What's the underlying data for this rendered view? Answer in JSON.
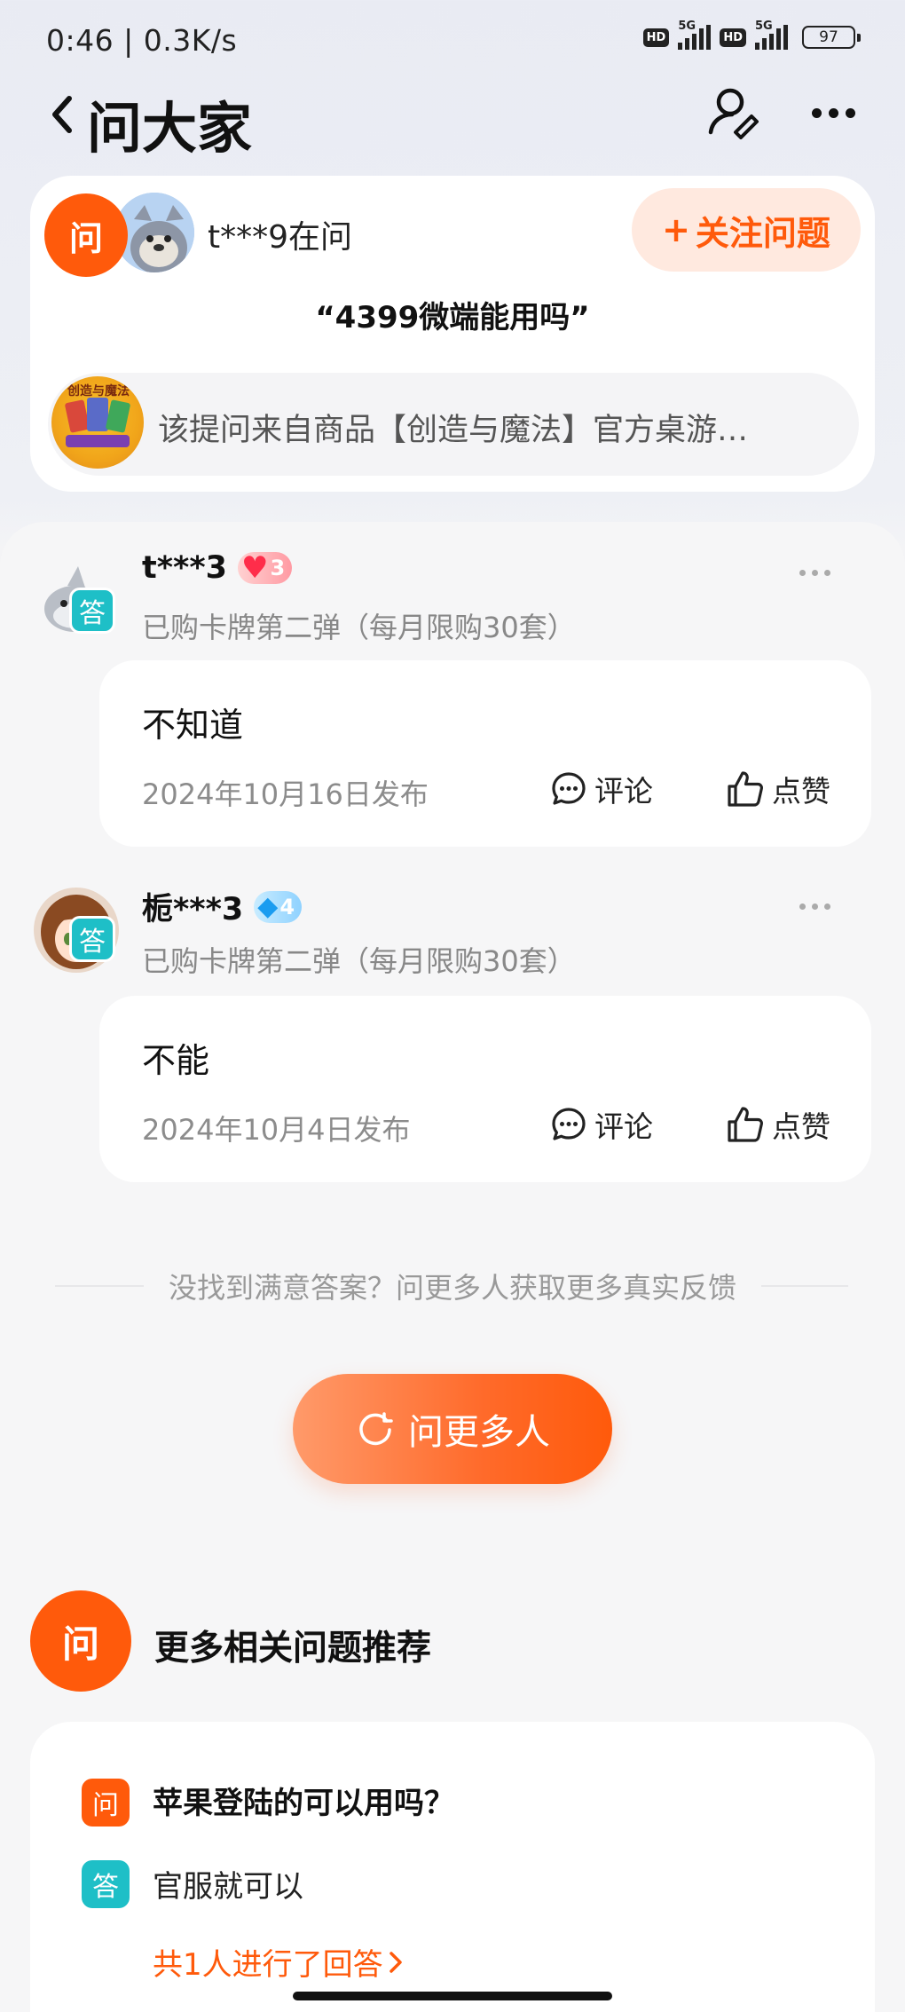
{
  "status_bar": {
    "time": "0:46",
    "speed": "0.3K/s",
    "hd1": "HD",
    "net1": "5G",
    "hd2": "HD",
    "net2": "5G",
    "battery": "97"
  },
  "header": {
    "title": "问大家",
    "back_icon": "chevron-left-icon",
    "search_icon": "user-search-icon",
    "more_icon": "more-horizontal-icon"
  },
  "question": {
    "badge": "问",
    "asker": "t***9在问",
    "follow_label": "关注问题",
    "follow_plus": "+",
    "text": "“4399微端能用吗”",
    "product_text": "该提问来自商品【创造与魔法】官方桌游…",
    "product_thumb_text": "创造与魔法"
  },
  "answers": [
    {
      "user": "t***3",
      "level": "3",
      "level_icon": "heart-icon",
      "badge": "答",
      "purchase": "已购卡牌第二弹（每月限购30套）",
      "content": "不知道",
      "date": "2024年10月16日发布",
      "comment_label": "评论",
      "like_label": "点赞"
    },
    {
      "user": "栀***3",
      "level": "4",
      "level_icon": "diamond-icon",
      "badge": "答",
      "purchase": "已购卡牌第二弹（每月限购30套）",
      "content": "不能",
      "date": "2024年10月4日发布",
      "comment_label": "评论",
      "like_label": "点赞"
    }
  ],
  "prompt": "没找到满意答案？问更多人获取更多真实反馈",
  "ask_more_label": "问更多人",
  "related": {
    "badge": "问",
    "title": "更多相关问题推荐",
    "items": [
      {
        "q_badge": "问",
        "question": "苹果登陆的可以用吗？",
        "a_badge": "答",
        "answer": "官服就可以",
        "link": "共1人进行了回答"
      }
    ]
  },
  "colors": {
    "accent": "#ff5a0b",
    "answer_badge": "#1ebfc7",
    "follow_bg": "#ffe9df"
  }
}
